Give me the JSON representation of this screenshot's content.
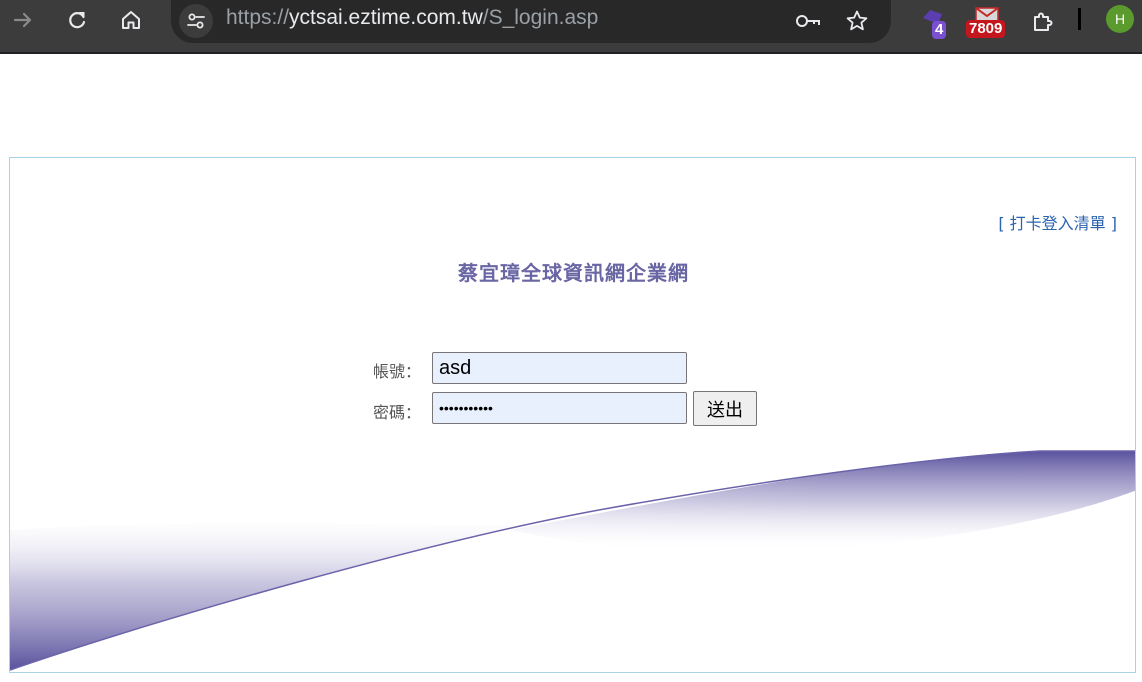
{
  "browser": {
    "url_scheme": "https://",
    "url_host": "yctsai.eztime.com.tw",
    "url_path": "/S_login.asp",
    "ext_badge_1": "4",
    "ext_badge_2": "7809",
    "profile_initial": "H"
  },
  "page": {
    "punch_link_open": "[ ",
    "punch_link_label": "打卡登入清單",
    "punch_link_close": " ]",
    "title": "蔡宜璋全球資訊網企業網",
    "form": {
      "account_label": "帳號：",
      "account_value": "asd",
      "password_label": "密碼：",
      "password_value": "•••••••••••",
      "submit_label": "送出"
    }
  },
  "colors": {
    "title": "#6a66a3",
    "link": "#2a63b0",
    "wave": "#5d559f",
    "frame_border": "#a8d2e6",
    "autofill_bg": "#e8f0fe"
  }
}
